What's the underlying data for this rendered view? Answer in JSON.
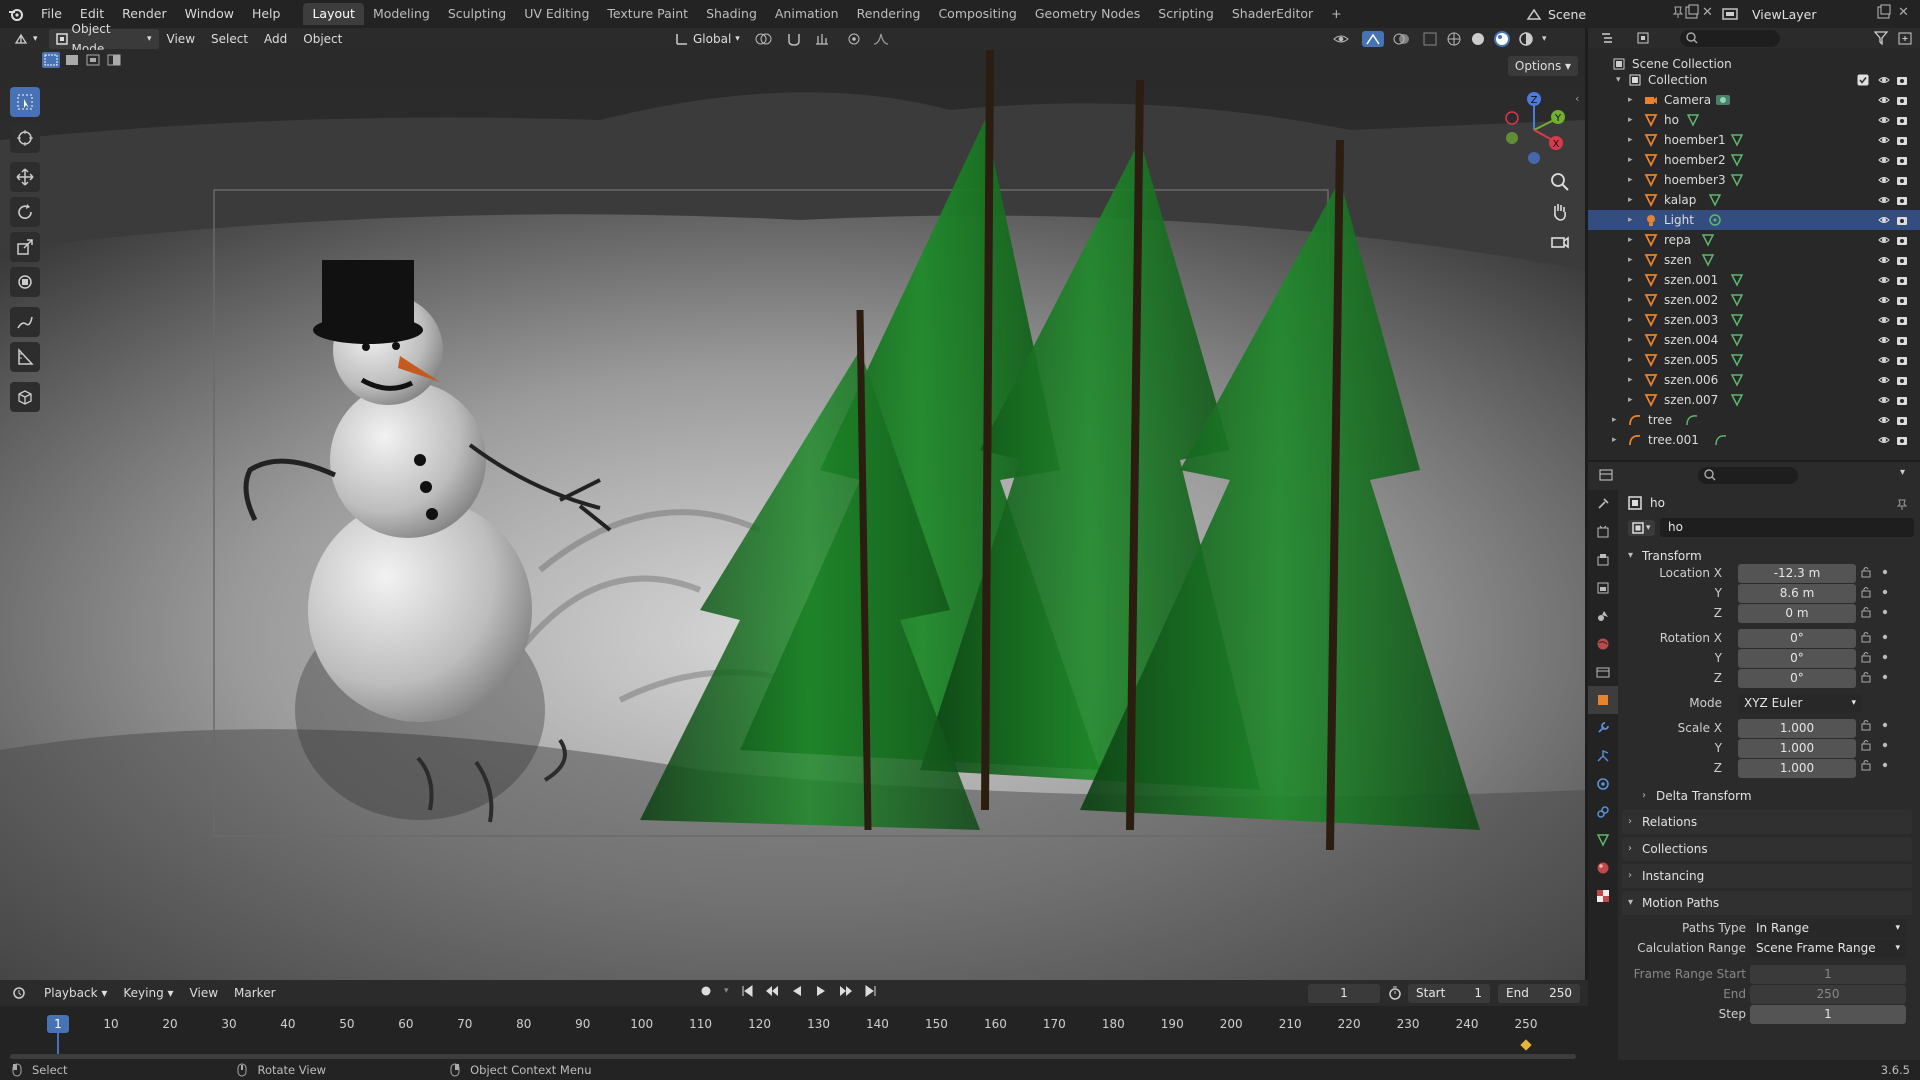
{
  "topbar": {
    "menus": [
      "File",
      "Edit",
      "Render",
      "Window",
      "Help"
    ],
    "workspaces": [
      "Layout",
      "Modeling",
      "Sculpting",
      "UV Editing",
      "Texture Paint",
      "Shading",
      "Animation",
      "Rendering",
      "Compositing",
      "Geometry Nodes",
      "Scripting",
      "ShaderEditor"
    ],
    "active_workspace": "Layout",
    "add_tab": "+",
    "scene": "Scene",
    "view_layer": "ViewLayer"
  },
  "viewport_header": {
    "mode": "Object Mode",
    "menus": [
      "View",
      "Select",
      "Add",
      "Object"
    ],
    "orientation": "Global",
    "options": "Options"
  },
  "viewport": {
    "accent": "#4772b3"
  },
  "outliner": {
    "root": "Scene Collection",
    "collection": "Collection",
    "items": [
      {
        "name": "Camera",
        "type": "camera"
      },
      {
        "name": "ho",
        "type": "mesh"
      },
      {
        "name": "hoember1",
        "type": "mesh"
      },
      {
        "name": "hoember2",
        "type": "mesh"
      },
      {
        "name": "hoember3",
        "type": "mesh"
      },
      {
        "name": "kalap",
        "type": "mesh"
      },
      {
        "name": "Light",
        "type": "light",
        "selected": true
      },
      {
        "name": "repa",
        "type": "mesh"
      },
      {
        "name": "szen",
        "type": "mesh"
      },
      {
        "name": "szen.001",
        "type": "mesh"
      },
      {
        "name": "szen.002",
        "type": "mesh"
      },
      {
        "name": "szen.003",
        "type": "mesh"
      },
      {
        "name": "szen.004",
        "type": "mesh"
      },
      {
        "name": "szen.005",
        "type": "mesh"
      },
      {
        "name": "szen.006",
        "type": "mesh"
      },
      {
        "name": "szen.007",
        "type": "mesh"
      },
      {
        "name": "tree",
        "type": "curve"
      },
      {
        "name": "tree.001",
        "type": "curve"
      }
    ]
  },
  "properties": {
    "object_name": "ho",
    "object_field": "ho",
    "transform_title": "Transform",
    "location_label": "Location X",
    "rotation_label": "Rotation X",
    "scale_label": "Scale X",
    "y_label": "Y",
    "z_label": "Z",
    "location": [
      "-12.3 m",
      "8.6 m",
      "0 m"
    ],
    "rotation": [
      "0°",
      "0°",
      "0°"
    ],
    "mode_label": "Mode",
    "mode": "XYZ Euler",
    "scale": [
      "1.000",
      "1.000",
      "1.000"
    ],
    "delta_transform": "Delta Transform",
    "relations": "Relations",
    "collections": "Collections",
    "instancing": "Instancing",
    "motion_paths": "Motion Paths",
    "paths_type_label": "Paths Type",
    "paths_type": "In Range",
    "calc_range_label": "Calculation Range",
    "calc_range": "Scene Frame Range",
    "frame_range_start_label": "Frame Range Start",
    "frame_range_start": "1",
    "end_label": "End",
    "end": "250",
    "step_label": "Step",
    "step": "1"
  },
  "timeline": {
    "menus": [
      "Playback",
      "Keying",
      "View",
      "Marker"
    ],
    "current_frame": "1",
    "start_label": "Start",
    "start": "1",
    "end_label": "End",
    "end": "250",
    "ticks": [
      "1",
      "10",
      "20",
      "30",
      "40",
      "50",
      "60",
      "70",
      "80",
      "90",
      "100",
      "110",
      "120",
      "130",
      "140",
      "150",
      "160",
      "170",
      "180",
      "190",
      "200",
      "210",
      "220",
      "230",
      "240",
      "250"
    ]
  },
  "statusbar": {
    "select": "Select",
    "rotate_view": "Rotate View",
    "context_menu": "Object Context Menu",
    "version": "3.6.5"
  }
}
